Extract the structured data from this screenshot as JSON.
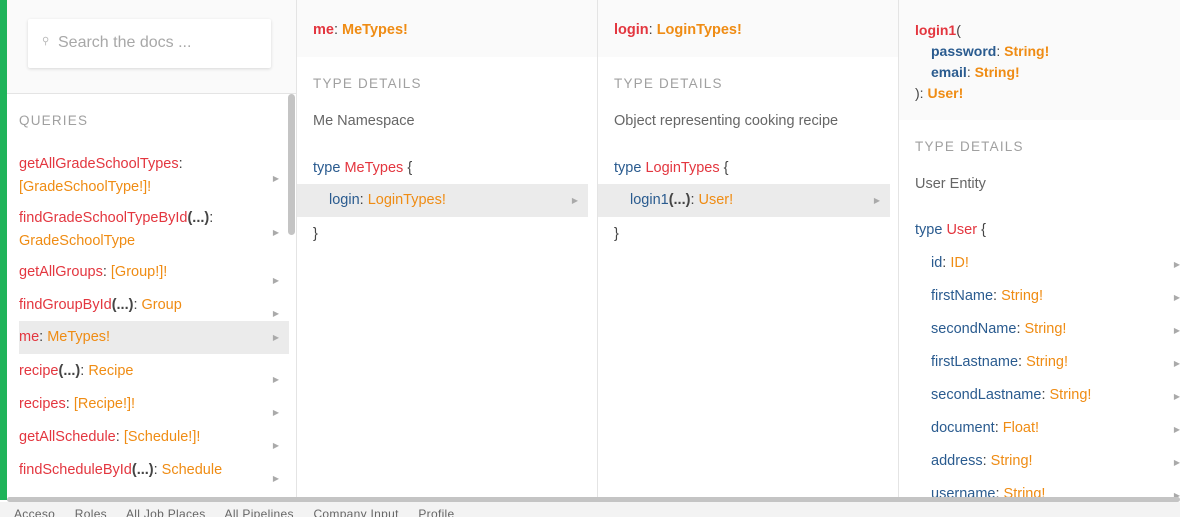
{
  "search": {
    "placeholder": "Search the docs ..."
  },
  "queries": {
    "section_title": "QUERIES",
    "items": [
      {
        "name": "getAllGradeSchoolTypes",
        "args": "",
        "sep": ":",
        "type": "[GradeSchoolType!]!"
      },
      {
        "name": "findGradeSchoolTypeById",
        "args": "(...)",
        "sep": ":",
        "type": "GradeSchoolType"
      },
      {
        "name": "getAllGroups",
        "args": "",
        "sep": ":",
        "type": "[Group!]!"
      },
      {
        "name": "findGroupById",
        "args": "(...)",
        "sep": ":",
        "type": "Group"
      },
      {
        "name": "me",
        "args": "",
        "sep": ":",
        "type": "MeTypes!"
      },
      {
        "name": "recipe",
        "args": "(...)",
        "sep": ":",
        "type": "Recipe"
      },
      {
        "name": "recipes",
        "args": "",
        "sep": ":",
        "type": "[Recipe!]!"
      },
      {
        "name": "getAllSchedule",
        "args": "",
        "sep": ":",
        "type": "[Schedule!]!"
      },
      {
        "name": "findScheduleById",
        "args": "(...)",
        "sep": ":",
        "type": "Schedule"
      }
    ]
  },
  "me_col": {
    "header_name": "me",
    "header_sep": ":",
    "header_type": "MeTypes!",
    "section_title": "TYPE DETAILS",
    "description": "Me Namespace",
    "type_kw": "type",
    "type_name": "MeTypes",
    "open_brace": "{",
    "close_brace": "}",
    "field": {
      "name": "login",
      "sep": ":",
      "type": "LoginTypes!"
    }
  },
  "login_col": {
    "header_name": "login",
    "header_sep": ":",
    "header_type": "LoginTypes!",
    "section_title": "TYPE DETAILS",
    "description": "Object representing cooking recipe",
    "type_kw": "type",
    "type_name": "LoginTypes",
    "open_brace": "{",
    "close_brace": "}",
    "field": {
      "name": "login1",
      "args": "(...)",
      "sep": ":",
      "type": "User!"
    }
  },
  "login1_col": {
    "header_name": "login1",
    "header_open": "(",
    "header_args": [
      {
        "name": "password",
        "sep": ":",
        "type": "String!"
      },
      {
        "name": "email",
        "sep": ":",
        "type": "String!"
      }
    ],
    "header_close": "):",
    "header_type": "User!",
    "section_title": "TYPE DETAILS",
    "description": "User Entity",
    "type_kw": "type",
    "type_name": "User",
    "open_brace": "{",
    "fields": [
      {
        "name": "id",
        "sep": ":",
        "type": "ID!"
      },
      {
        "name": "firstName",
        "sep": ":",
        "type": "String!"
      },
      {
        "name": "secondName",
        "sep": ":",
        "type": "String!"
      },
      {
        "name": "firstLastname",
        "sep": ":",
        "type": "String!"
      },
      {
        "name": "secondLastname",
        "sep": ":",
        "type": "String!"
      },
      {
        "name": "document",
        "sep": ":",
        "type": "Float!"
      },
      {
        "name": "address",
        "sep": ":",
        "type": "String!"
      },
      {
        "name": "username",
        "sep": ":",
        "type": "String!"
      }
    ]
  },
  "bottom_bar": {
    "items": [
      "Acceso",
      "Roles",
      "All Job Places",
      "All Pipelines",
      "Company Input",
      "Profile"
    ]
  },
  "colors": {
    "accent_green": "#1fb35a",
    "field_red": "#e3363f",
    "type_orange": "#ef8c14",
    "keyword_blue": "#2a5b8f"
  },
  "icons": {
    "search": "search-icon",
    "arrow": "chevron-right-icon"
  }
}
